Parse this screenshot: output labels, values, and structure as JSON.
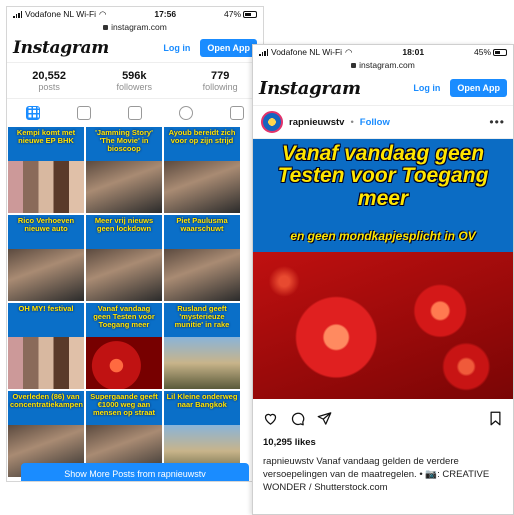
{
  "left_phone": {
    "status": {
      "carrier": "Vodafone NL Wi-Fi",
      "time": "17:56",
      "battery": "47%"
    },
    "url": "instagram.com",
    "header": {
      "logo": "Instagram",
      "login": "Log in",
      "open_app": "Open App"
    },
    "stats": [
      {
        "value": "20,552",
        "label": "posts"
      },
      {
        "value": "596k",
        "label": "followers"
      },
      {
        "value": "779",
        "label": "following"
      }
    ],
    "tabs": [
      "grid-icon",
      "igtv-icon",
      "reels-icon",
      "video-icon",
      "tagged-icon"
    ],
    "posts": [
      "Kempi komt met nieuwe EP BHK",
      "'Jamming Story' 'The Movie' in bioscoop",
      "Ayoub bereidt zich voor op zijn strijd",
      "Rico Verhoeven nieuwe auto",
      "Meer vrij nieuws geen lockdown",
      "Piet Paulusma waarschuwt",
      "OH MY! festival",
      "Vanaf vandaag geen Testen voor Toegang meer",
      "Rusland geeft 'mysterieuze munitie' in rake",
      "Overleden (86) van concentratiekampen",
      "Supergaande geeft €1000 weg aan mensen op straat",
      "Lil Kleine onderweg naar Bangkok"
    ],
    "show_more": "Show More Posts from rapnieuwstv"
  },
  "right_phone": {
    "status": {
      "carrier": "Vodafone NL Wi-Fi",
      "time": "18:01",
      "battery": "45%"
    },
    "url": "instagram.com",
    "header": {
      "logo": "Instagram",
      "login": "Log in",
      "open_app": "Open App"
    },
    "profile": {
      "username": "rapnieuwstv",
      "separator": "•",
      "follow": "Follow",
      "more": "•••"
    },
    "post": {
      "headline": "Vanaf vandaag geen Testen voor Toegang meer",
      "subheadline": "en geen mondkapjesplicht in OV"
    },
    "likes": "10,295 likes",
    "caption": {
      "username": "rapnieuwstv",
      "text": "Vanaf vandaag gelden de verdere versoepelingen van de maatregelen. • 📷: CREATIVE WONDER / Shutterstock.com"
    }
  }
}
